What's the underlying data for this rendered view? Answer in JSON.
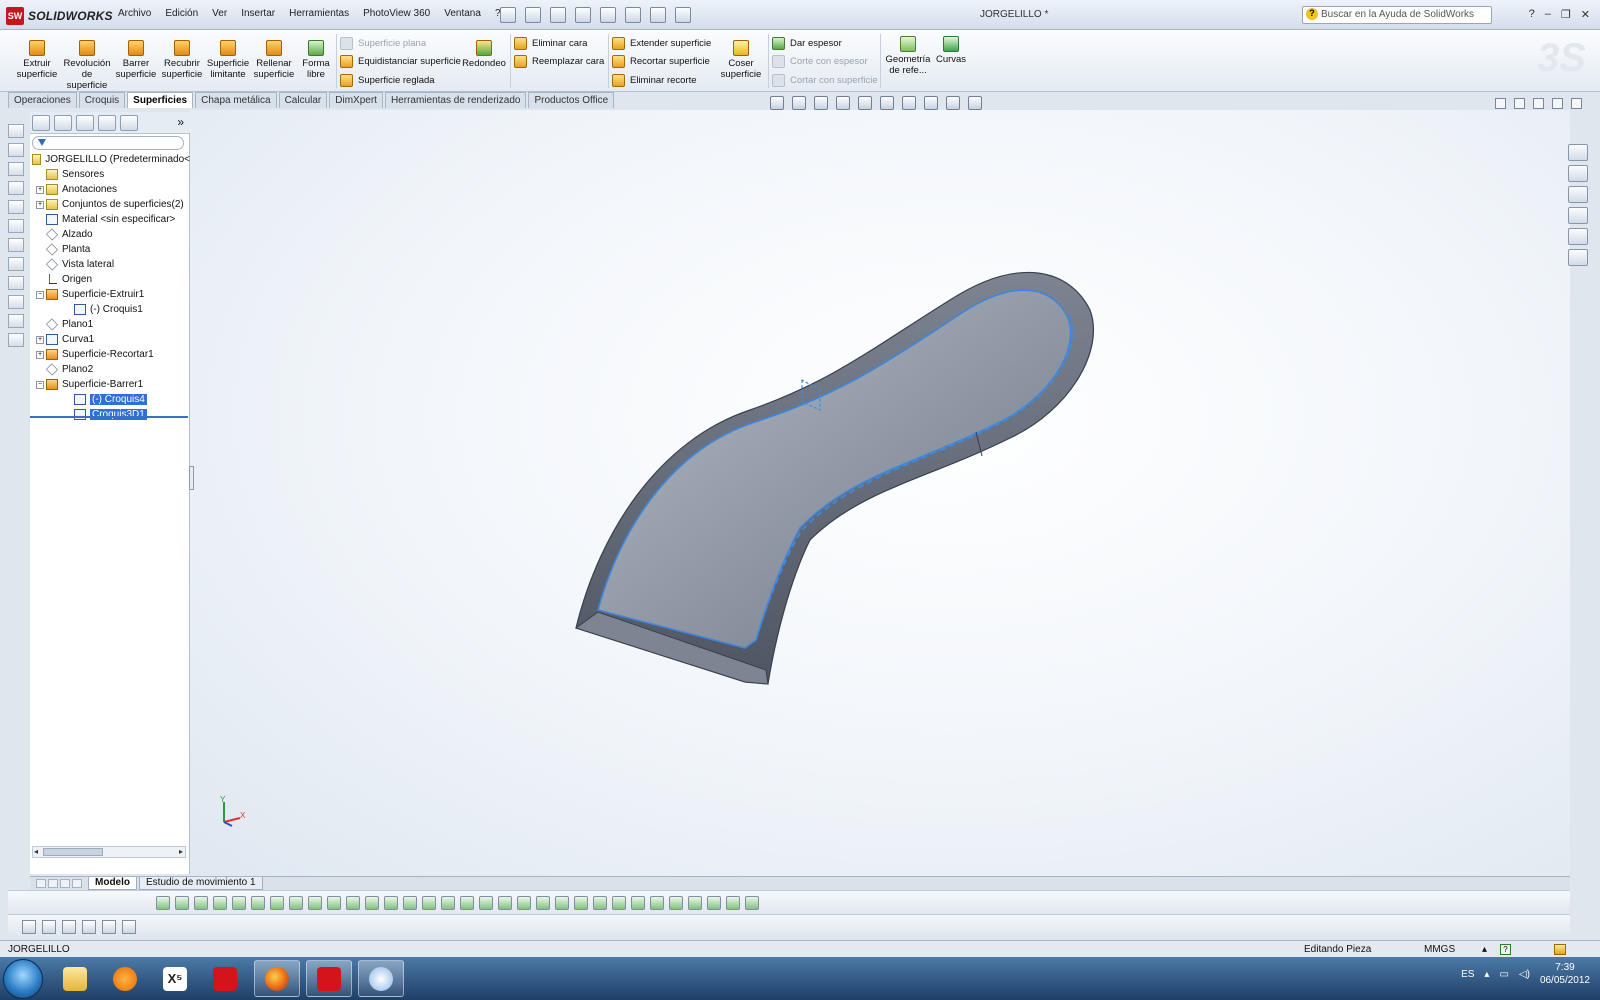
{
  "app": {
    "brand": "SOLIDWORKS",
    "logo_badge": "SW",
    "document_title": "JORGELILLO *"
  },
  "menu": [
    "Archivo",
    "Edición",
    "Ver",
    "Insertar",
    "Herramientas",
    "PhotoView 360",
    "Ventana",
    "?"
  ],
  "help_search": {
    "placeholder": "Buscar en la Ayuda de SolidWorks"
  },
  "command_manager": {
    "large_buttons": [
      "Extruir\nsuperficie",
      "Revolución\nde\nsuperficie",
      "Barrer\nsuperficie",
      "Recubrir\nsuperficie",
      "Superficie\nlimitante",
      "Rellenar\nsuperficie",
      "Forma\nlibre"
    ],
    "group1": [
      "Superficie plana",
      "Equidistanciar superficie",
      "Superficie reglada"
    ],
    "redondeo": "Redondeo",
    "group2": [
      "Eliminar cara",
      "Reemplazar cara"
    ],
    "group3": [
      "Extender superficie",
      "Recortar superficie",
      "Eliminar recorte"
    ],
    "coser": "Coser\nsuperficie",
    "group4": [
      "Dar espesor",
      "Corte con espesor",
      "Cortar con superficie"
    ],
    "geometria": "Geometría\nde refe...",
    "curvas": "Curvas"
  },
  "tabs": [
    {
      "label": "Operaciones",
      "active": false
    },
    {
      "label": "Croquis",
      "active": false
    },
    {
      "label": "Superficies",
      "active": true
    },
    {
      "label": "Chapa metálica",
      "active": false
    },
    {
      "label": "Calcular",
      "active": false
    },
    {
      "label": "DimXpert",
      "active": false
    },
    {
      "label": "Herramientas de renderizado",
      "active": false
    },
    {
      "label": "Productos Office",
      "active": false
    }
  ],
  "tree": {
    "root": "JORGELILLO  (Predeterminado<",
    "nodes": [
      {
        "label": "Sensores",
        "icon": "folder",
        "expand": false,
        "indent": 1
      },
      {
        "label": "Anotaciones",
        "icon": "folder",
        "expand": true,
        "indent": 1
      },
      {
        "label": "Conjuntos de superficies(2)",
        "icon": "folder",
        "expand": true,
        "indent": 1
      },
      {
        "label": "Material <sin especificar>",
        "icon": "material",
        "expand": false,
        "indent": 1
      },
      {
        "label": "Alzado",
        "icon": "plane",
        "expand": false,
        "indent": 1
      },
      {
        "label": "Planta",
        "icon": "plane",
        "expand": false,
        "indent": 1
      },
      {
        "label": "Vista lateral",
        "icon": "plane",
        "expand": false,
        "indent": 1
      },
      {
        "label": "Origen",
        "icon": "origin",
        "expand": false,
        "indent": 1
      },
      {
        "label": "Superficie-Extruir1",
        "icon": "feat",
        "expand": "open",
        "indent": 1
      },
      {
        "label": "(-) Croquis1",
        "icon": "sketch",
        "expand": false,
        "indent": 2
      },
      {
        "label": "Plano1",
        "icon": "plane",
        "expand": false,
        "indent": 1
      },
      {
        "label": "Curva1",
        "icon": "curve",
        "expand": true,
        "indent": 1
      },
      {
        "label": "Superficie-Recortar1",
        "icon": "feat",
        "expand": true,
        "indent": 1
      },
      {
        "label": "Plano2",
        "icon": "plane",
        "expand": false,
        "indent": 1
      },
      {
        "label": "Superficie-Barrer1",
        "icon": "feat",
        "expand": "open",
        "indent": 1
      },
      {
        "label": "(-) Croquis4",
        "icon": "sketch",
        "expand": false,
        "indent": 2,
        "selected": true
      },
      {
        "label": "Croquis3D1",
        "icon": "sketch",
        "expand": false,
        "indent": 2,
        "selected": true
      }
    ]
  },
  "bottom_tabs": [
    {
      "label": "Modelo",
      "active": true
    },
    {
      "label": "Estudio de movimiento 1",
      "active": false
    }
  ],
  "status": {
    "part": "JORGELILLO",
    "mode": "Editando Pieza",
    "units": "MMGS"
  },
  "taskbar": {
    "lang": "ES",
    "time": "7:39",
    "date": "06/05/2012"
  },
  "triad": {
    "y": "Y",
    "x": "X"
  },
  "colors": {
    "model": "#8a93a4",
    "selection": "#2f6fd6",
    "edge_highlight": "#3a8de8"
  }
}
